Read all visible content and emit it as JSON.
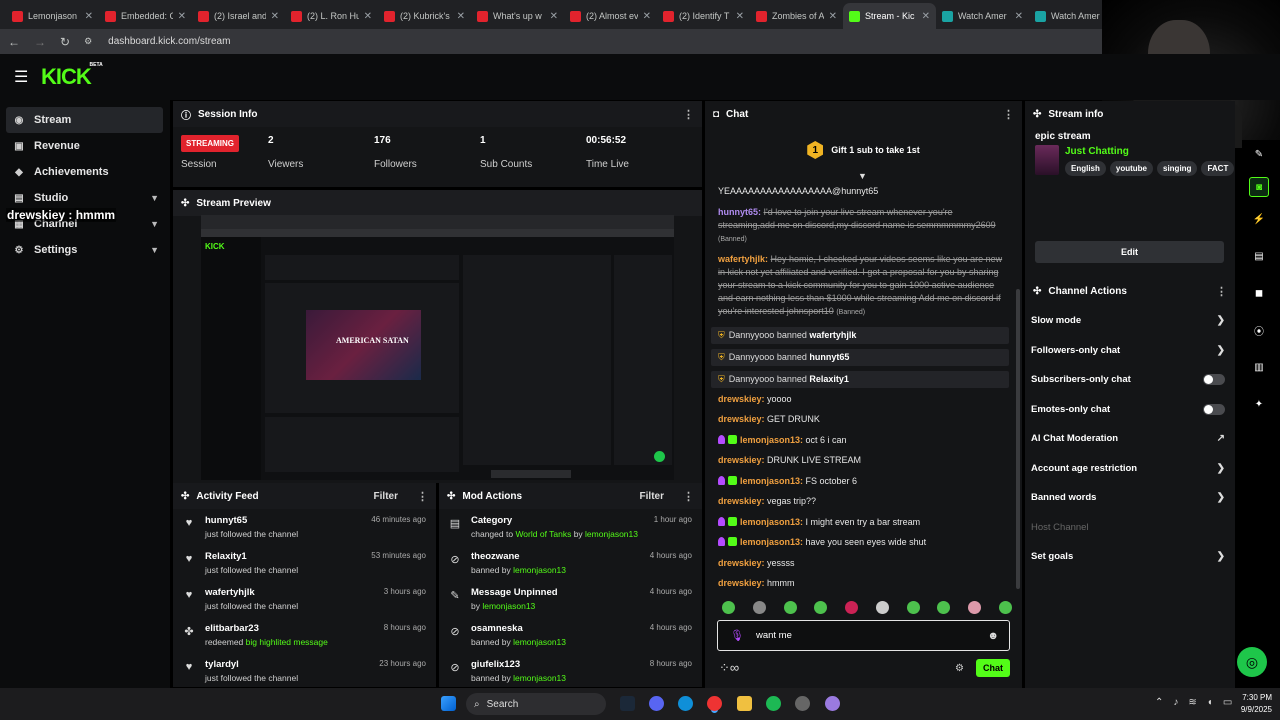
{
  "browser": {
    "tabs": [
      {
        "title": "Lemonjason",
        "color": "#e1232d"
      },
      {
        "title": "Embedded: C",
        "color": "#e1232d"
      },
      {
        "title": "(2) Israel and",
        "color": "#e1232d"
      },
      {
        "title": "(2) L. Ron Hu",
        "color": "#e1232d"
      },
      {
        "title": "(2) Kubrick's",
        "color": "#e1232d"
      },
      {
        "title": "What's up w",
        "color": "#e1232d"
      },
      {
        "title": "(2) Almost ev",
        "color": "#e1232d"
      },
      {
        "title": "(2) Identify T",
        "color": "#e1232d"
      },
      {
        "title": "Zombies of A",
        "color": "#e1232d"
      },
      {
        "title": "Stream - Kic",
        "color": "#53fc18",
        "active": true
      },
      {
        "title": "Watch Amer",
        "color": "#1aa3a3"
      },
      {
        "title": "Watch Amer",
        "color": "#1aa3a3"
      }
    ],
    "url": "dashboard.kick.com/stream"
  },
  "brand": {
    "logo": "KICK",
    "beta": "BETA"
  },
  "sidebar": {
    "items": [
      {
        "label": "Stream",
        "icon": "stream-icon",
        "glyph": "◉",
        "active": true
      },
      {
        "label": "Revenue",
        "icon": "revenue-icon",
        "glyph": "▣"
      },
      {
        "label": "Achievements",
        "icon": "trophy-icon",
        "glyph": "◆"
      },
      {
        "label": "Studio",
        "icon": "studio-icon",
        "glyph": "▤",
        "chevron": "⌄"
      },
      {
        "label": "Channel",
        "icon": "channel-icon",
        "glyph": "▦",
        "chevron": "⌄"
      },
      {
        "label": "Settings",
        "icon": "gear-icon",
        "glyph": "⚙",
        "chevron": "⌄"
      }
    ]
  },
  "overlay_text": "drewskiey : hmmm",
  "session": {
    "title": "Session Info",
    "status": "STREAMING",
    "status_label": "Session",
    "stats": [
      {
        "value": "2",
        "label": "Viewers"
      },
      {
        "value": "176",
        "label": "Followers"
      },
      {
        "value": "1",
        "label": "Sub Counts"
      },
      {
        "value": "00:56:52",
        "label": "Time Live"
      }
    ]
  },
  "preview": {
    "title": "Stream Preview",
    "mini_title": "AMERICAN SATAN"
  },
  "activity": {
    "title": "Activity Feed",
    "filter": "Filter",
    "items": [
      {
        "name": "hunnyt65",
        "text": "just followed the channel",
        "time": "46 minutes ago",
        "icon": "heart-icon",
        "glyph": "♥"
      },
      {
        "name": "Relaxity1",
        "text": "just followed the channel",
        "time": "53 minutes ago",
        "icon": "heart-icon",
        "glyph": "♥"
      },
      {
        "name": "wafertyhjlk",
        "text": "just followed the channel",
        "time": "3 hours ago",
        "icon": "heart-icon",
        "glyph": "♥"
      },
      {
        "name": "elitbarbar23",
        "text_pre": "redeemed ",
        "text_hl": "big highlited message",
        "time": "8 hours ago",
        "icon": "redeem-icon",
        "glyph": "✤"
      },
      {
        "name": "tylardyl",
        "text": "just followed the channel",
        "time": "23 hours ago",
        "icon": "heart-icon",
        "glyph": "♥"
      }
    ]
  },
  "modactions": {
    "title": "Mod Actions",
    "filter": "Filter",
    "items": [
      {
        "name": "Category",
        "pre": "changed to ",
        "hl1": "World of Tanks",
        "mid": " by ",
        "hl2": "lemonjason13",
        "time": "1 hour ago",
        "icon": "category-icon",
        "glyph": "▤"
      },
      {
        "name": "theozwane",
        "pre": "banned by ",
        "hl1": "",
        "mid": "",
        "hl2": "lemonjason13",
        "time": "4 hours ago",
        "icon": "ban-icon",
        "glyph": "⊘"
      },
      {
        "name": "Message Unpinned",
        "pre": "by ",
        "hl1": "",
        "mid": "",
        "hl2": "lemonjason13",
        "time": "4 hours ago",
        "icon": "unpin-icon",
        "glyph": "✎"
      },
      {
        "name": "osamneska",
        "pre": "banned by ",
        "hl1": "",
        "mid": "",
        "hl2": "lemonjason13",
        "time": "4 hours ago",
        "icon": "ban-icon",
        "glyph": "⊘"
      },
      {
        "name": "giufelix123",
        "pre": "banned by ",
        "hl1": "",
        "mid": "",
        "hl2": "lemonjason13",
        "time": "8 hours ago",
        "icon": "ban-icon",
        "glyph": "⊘"
      }
    ]
  },
  "chat": {
    "title": "Chat",
    "gift": {
      "count": "1",
      "text": "Gift 1 sub to take 1st"
    },
    "messages": [
      {
        "type": "msg",
        "text": "YEAAAAAAAAAAAAAAAAA@hunnyt65"
      },
      {
        "type": "msg",
        "user": "hunnyt65",
        "ucolor": "#b08cf0",
        "text": "I'd love to join your live stream whenever you're streaming,add me on discord,my discord name is semmmmmmy2609",
        "suffix": "(Banned)",
        "struck": true
      },
      {
        "type": "msg",
        "user": "wafertyhjlk",
        "ucolor": "#f0a040",
        "text": "Hey homie, I checked your videos seems like you are new in kick not yet affiliated and verified. I got a proposal for you by sharing your stream to a kick community for you to gain 1000 active audience and earn nothing less than $1000 while streaming Add me on discord if you're interested johnsport10",
        "suffix": "(Banned)",
        "struck": true
      },
      {
        "type": "sys",
        "actor": "Dannyyooo",
        "action": "banned",
        "target": "wafertyhjlk"
      },
      {
        "type": "sys",
        "actor": "Dannyyooo",
        "action": "banned",
        "target": "hunnyt65"
      },
      {
        "type": "sys",
        "actor": "Dannyyooo",
        "action": "banned",
        "target": "Relaxity1"
      },
      {
        "type": "msg",
        "user": "drewskiey",
        "ucolor": "#f0a040",
        "text": "yoooo"
      },
      {
        "type": "msg",
        "user": "drewskiey",
        "ucolor": "#f0a040",
        "text": "GET DRUNK"
      },
      {
        "type": "msg",
        "user": "lemonjason13",
        "ucolor": "#f0a040",
        "badges": true,
        "text": "oct 6 i can"
      },
      {
        "type": "msg",
        "user": "drewskiey",
        "ucolor": "#f0a040",
        "text": "DRUNK LIVE STREAM"
      },
      {
        "type": "msg",
        "user": "lemonjason13",
        "ucolor": "#f0a040",
        "badges": true,
        "text": "FS october 6"
      },
      {
        "type": "msg",
        "user": "drewskiey",
        "ucolor": "#f0a040",
        "text": "vegas trip??"
      },
      {
        "type": "msg",
        "user": "lemonjason13",
        "ucolor": "#f0a040",
        "badges": true,
        "text": "I might even try a bar stream"
      },
      {
        "type": "msg",
        "user": "lemonjason13",
        "ucolor": "#f0a040",
        "badges": true,
        "text": "have you seen eyes wide shut"
      },
      {
        "type": "msg",
        "user": "drewskiey",
        "ucolor": "#f0a040",
        "text": "yessss"
      },
      {
        "type": "msg",
        "user": "drewskiey",
        "ucolor": "#f0a040",
        "text": "hmmm"
      }
    ],
    "input_value": "want me",
    "send_label": "Chat"
  },
  "stream_info": {
    "title": "Stream info",
    "stream_title": "epic stream",
    "category": "Just Chatting",
    "tags": [
      "English",
      "youtube",
      "singing",
      "FACT"
    ],
    "edit_label": "Edit"
  },
  "channel_actions": {
    "title": "Channel Actions",
    "items": [
      {
        "label": "Slow mode",
        "control": "arrow"
      },
      {
        "label": "Followers-only chat",
        "control": "arrow"
      },
      {
        "label": "Subscribers-only chat",
        "control": "toggle"
      },
      {
        "label": "Emotes-only chat",
        "control": "toggle"
      },
      {
        "label": "AI Chat Moderation",
        "control": "external"
      },
      {
        "label": "Account age restriction",
        "control": "arrow"
      },
      {
        "label": "Banned words",
        "control": "arrow"
      },
      {
        "label": "Host Channel",
        "control": "none",
        "disabled": true
      },
      {
        "label": "Set goals",
        "control": "arrow"
      }
    ]
  },
  "taskbar": {
    "search": "Search",
    "time": "7:30 PM",
    "date": "9/9/2025"
  },
  "colors": {
    "kick_green": "#53fc18",
    "live_red": "#e1232d",
    "panel": "#141517"
  }
}
